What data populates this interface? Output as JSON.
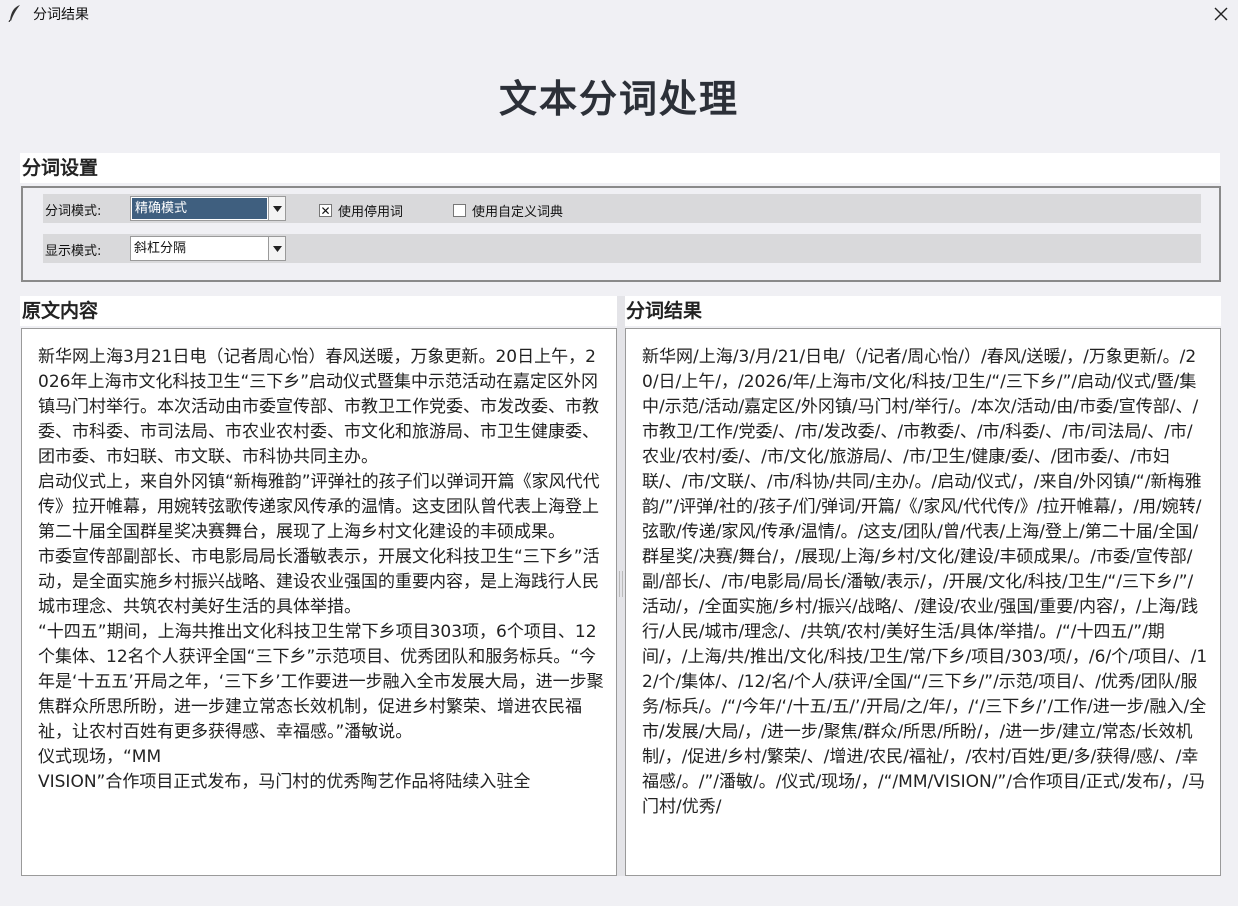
{
  "window": {
    "title": "分词结果",
    "icon": "feather-icon",
    "close_icon": "close-icon"
  },
  "page": {
    "heading": "文本分词处理"
  },
  "settings": {
    "section_title": "分词设置",
    "mode_label": "分词模式:",
    "mode_value": "精确模式",
    "use_stopwords_label": "使用停用词",
    "use_stopwords_checked": true,
    "use_custom_dict_label": "使用自定义词典",
    "use_custom_dict_checked": false,
    "display_label": "显示模式:",
    "display_value": "斜杠分隔"
  },
  "original": {
    "title": "原文内容",
    "text": "新华网上海3月21日电（记者周心怡）春风送暖，万象更新。20日上午，2026年上海市文化科技卫生“三下乡”启动仪式暨集中示范活动在嘉定区外冈镇马门村举行。本次活动由市委宣传部、市教卫工作党委、市发改委、市教委、市科委、市司法局、市农业农村委、市文化和旅游局、市卫生健康委、团市委、市妇联、市文联、市科协共同主办。\n启动仪式上，来自外冈镇“新梅雅韵”评弹社的孩子们以弹词开篇《家风代代传》拉开帷幕，用婉转弦歌传递家风传承的温情。这支团队曾代表上海登上第二十届全国群星奖决赛舞台，展现了上海乡村文化建设的丰硕成果。\n市委宣传部副部长、市电影局局长潘敏表示，开展文化科技卫生“三下乡”活动，是全面实施乡村振兴战略、建设农业强国的重要内容，是上海践行人民城市理念、共筑农村美好生活的具体举措。\n“十四五”期间，上海共推出文化科技卫生常下乡项目303项，6个项目、12个集体、12名个人获评全国“三下乡”示范项目、优秀团队和服务标兵。“今年是‘十五五’开局之年，‘三下乡’工作要进一步融入全市发展大局，进一步聚焦群众所思所盼，进一步建立常态长效机制，促进乡村繁荣、增进农民福祉，让农村百姓有更多获得感、幸福感。”潘敏说。\n仪式现场，“MM\nVISION”合作项目正式发布，马门村的优秀陶艺作品将陆续入驻全"
  },
  "result": {
    "title": "分词结果",
    "text": "新华网/上海/3/月/21/日电/（/记者/周心怡/）/春风/送暖/，/万象更新/。/20/日/上午/，/2026/年/上海市/文化/科技/卫生/“/三下乡/”/启动/仪式/暨/集中/示范/活动/嘉定区/外冈镇/马门村/举行/。/本次/活动/由/市委/宣传部/、/市教卫/工作/党委/、/市/发改委/、/市教委/、/市/科委/、/市/司法局/、/市/农业/农村/委/、/市/文化/旅游局/、/市/卫生/健康/委/、/团市委/、/市妇联/、/市/文联/、/市/科协/共同/主办/。/启动/仪式/，/来自/外冈镇/“/新梅雅韵/”/评弹/社的/孩子/们/弹词/开篇/《/家风/代代传/》/拉开帷幕/，/用/婉转/弦歌/传递/家风/传承/温情/。/这支/团队/曾/代表/上海/登上/第二十届/全国/群星奖/决赛/舞台/，/展现/上海/乡村/文化/建设/丰硕成果/。/市委/宣传部/副/部长/、/市/电影局/局长/潘敏/表示/，/开展/文化/科技/卫生/“/三下乡/”/活动/，/全面实施/乡村/振兴/战略/、/建设/农业/强国/重要/内容/，/上海/践行/人民/城市/理念/、/共筑/农村/美好生活/具体/举措/。/“/十四五/”/期间/，/上海/共/推出/文化/科技/卫生/常/下乡/项目/303/项/，/6/个/项目/、/12/个/集体/、/12/名/个人/获评/全国/“/三下乡/”/示范/项目/、/优秀/团队/服务/标兵/。/“/今年/‘/十五/五/’/开局/之/年/，/‘/三下乡/’/工作/进一步/融入/全市/发展/大局/，/进一步/聚焦/群众/所思/所盼/，/进一步/建立/常态/长效机制/，/促进/乡村/繁荣/、/增进/农民/福祉/，/农村/百姓/更/多/获得/感/、/幸福感/。/”/潘敏/。/仪式/现场/，/“/MM/VISION/”/合作项目/正式/发布/，/马门村/优秀/"
  }
}
